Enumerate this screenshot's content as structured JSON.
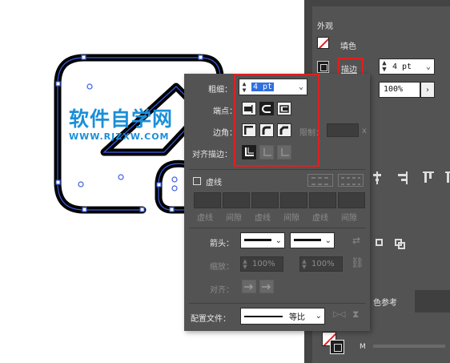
{
  "watermark": {
    "title": "软件自学网",
    "url": "WWW.RJZXW.COM"
  },
  "appearance_panel": {
    "title": "外观",
    "fill_label": "填色",
    "stroke_label": "描边",
    "stroke_weight": "4 pt",
    "opacity": "100%",
    "tab_partial": "色参考",
    "bottom_letter": "M"
  },
  "stroke_popup": {
    "weight_label": "粗细：",
    "weight_value": "4 pt",
    "cap_label": "端点：",
    "corner_label": "边角：",
    "limit_label": "限制：",
    "limit_suffix": "x",
    "align_label": "对齐描边：",
    "dashed_label": "虚线",
    "dash_fields": [
      "虚线",
      "间隙",
      "虚线",
      "间隙",
      "虚线",
      "间隙"
    ],
    "arrow_label": "箭头：",
    "scale_label": "缩放：",
    "scale_values": [
      "100%",
      "100%"
    ],
    "align_arrow_label": "对齐：",
    "profile_label": "配置文件：",
    "profile_value": "等比"
  },
  "colors": {
    "accent_red": "#e02020",
    "panel_bg": "#535353",
    "stroke_black": "#000000",
    "path_blue": "#3d5fe0"
  }
}
